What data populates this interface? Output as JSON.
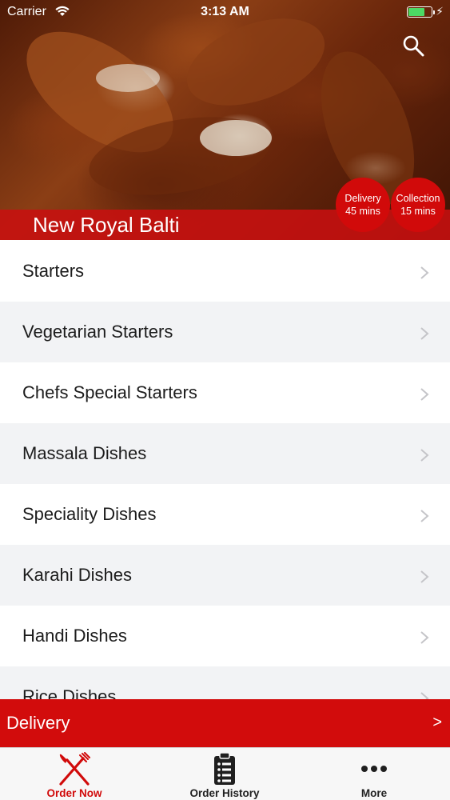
{
  "status_bar": {
    "carrier": "Carrier",
    "time": "3:13 AM",
    "battery_color": "#4cd964"
  },
  "header": {
    "restaurant_name": "New Royal Balti",
    "search_icon": "search-icon",
    "delivery_badge": {
      "label": "Delivery",
      "time": "45 mins"
    },
    "collection_badge": {
      "label": "Collection",
      "time": "15 mins"
    },
    "accent_color": "#d10a0a"
  },
  "menu": {
    "items": [
      {
        "label": "Starters"
      },
      {
        "label": "Vegetarian Starters"
      },
      {
        "label": "Chefs Special Starters"
      },
      {
        "label": "Massala Dishes"
      },
      {
        "label": "Speciality Dishes"
      },
      {
        "label": "Karahi Dishes"
      },
      {
        "label": "Handi Dishes"
      },
      {
        "label": "Rice Dishes"
      }
    ]
  },
  "delivery_bar": {
    "label": "Delivery",
    "arrow": ">"
  },
  "tab_bar": {
    "tabs": [
      {
        "label": "Order Now",
        "icon": "fork-knife-icon",
        "active": true
      },
      {
        "label": "Order History",
        "icon": "clipboard-list-icon",
        "active": false
      },
      {
        "label": "More",
        "icon": "more-dots-icon",
        "active": false
      }
    ]
  }
}
